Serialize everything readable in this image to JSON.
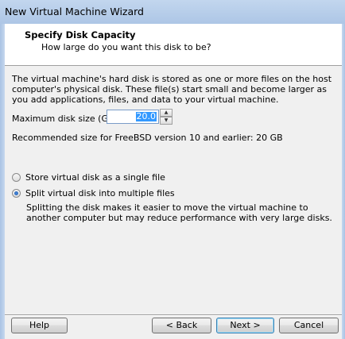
{
  "window": {
    "title": "New Virtual Machine Wizard"
  },
  "header": {
    "title": "Specify Disk Capacity",
    "subtitle": "How large do you want this disk to be?"
  },
  "body": {
    "description": "The virtual machine's hard disk is stored as one or more files on the host computer's physical disk. These file(s) start small and become larger as you add applications, files, and data to your virtual machine.",
    "max_size_label": "Maximum disk size (GB):",
    "max_size_value": "20.0",
    "recommended": "Recommended size for FreeBSD version 10 and earlier: 20 GB",
    "options": [
      {
        "label": "Store virtual disk as a single file",
        "selected": false
      },
      {
        "label": "Split virtual disk into multiple files",
        "selected": true
      }
    ],
    "split_description": "Splitting the disk makes it easier to move the virtual machine to another computer but may reduce performance with very large disks."
  },
  "buttons": {
    "help": "Help",
    "back": "< Back",
    "next": "Next >",
    "cancel": "Cancel"
  },
  "icons": {
    "spin_up": "spin-up-arrow-icon",
    "spin_down": "spin-down-arrow-icon"
  }
}
